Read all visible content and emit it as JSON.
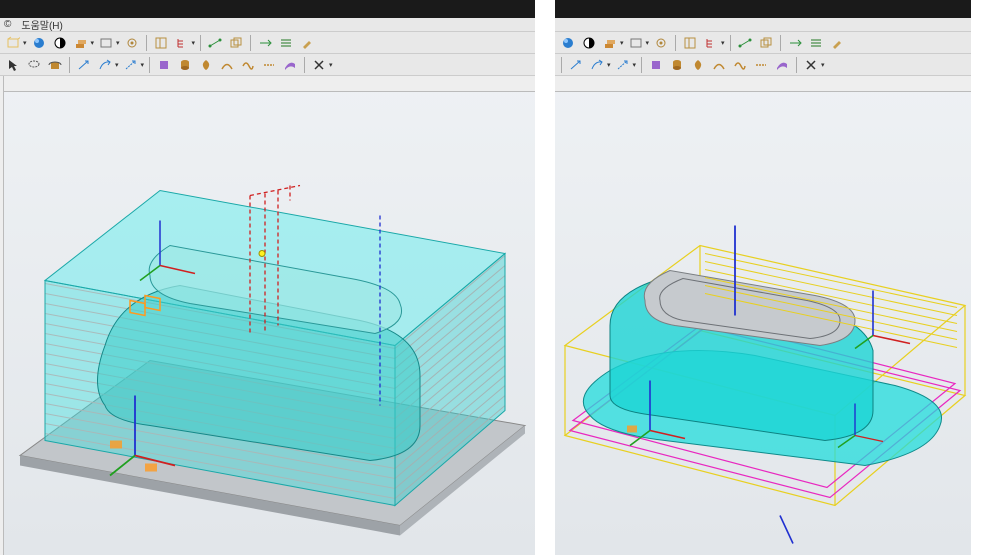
{
  "menus": {
    "windowHint": "©",
    "help": "도움말(H)"
  },
  "toolbar1": {
    "icons": [
      "box",
      "sphere",
      "halfblack",
      "boxstack",
      "rect",
      "dropdown",
      "gear",
      "sep",
      "clip",
      "tree",
      "dropdown",
      "sep",
      "dim",
      "dup",
      "sep",
      "align",
      "lines",
      "brush"
    ],
    "colors": {
      "box": "#e6c060",
      "sphere": "#2a7dcf",
      "halfblack": "#000000",
      "boxstack": "#cc8833",
      "rect": "#999999",
      "gear": "#b0863a",
      "clip": "#b89040",
      "tree": "#c03030",
      "dim": "#2a8f3a",
      "dup": "#b89040",
      "align": "#2a8f3a",
      "lines": "#227722",
      "brush": "#c9a050"
    }
  },
  "toolbar2": {
    "icons": [
      "ptr",
      "lasso",
      "rotcube",
      "sep",
      "arrow",
      "arrowpath",
      "dropdown",
      "arrowdash",
      "dropdown",
      "sep",
      "boxtool",
      "cyl",
      "lathe",
      "curve",
      "curve2",
      "dash",
      "sweep",
      "sep",
      "x",
      "dropdown"
    ],
    "colors": {
      "ptr": "#333333",
      "lasso": "#555555",
      "rotcube": "#c08830",
      "arrow": "#2a7dcf",
      "arrowpath": "#2a7dcf",
      "arrowdash": "#2a7dcf",
      "boxtool": "#9966cc",
      "cyl": "#c08830",
      "lathe": "#c08830",
      "curve": "#c08830",
      "curve2": "#c08830",
      "dash": "#c08830",
      "sweep": "#9966cc",
      "x": "#333333"
    }
  },
  "scene_left": {
    "stock_color": "#38e0e0",
    "stock_opacity": 0.45,
    "toolpath_color": "#ff6e6e",
    "base_color": "#b5b9bd",
    "axis_colors": {
      "x": "#d02020",
      "y": "#20a020",
      "z": "#2030d0"
    }
  },
  "scene_right": {
    "stock_color": "#20e0e0",
    "stock_opacity": 0.55,
    "box_colors": [
      "#ff2ad0",
      "#ffee20",
      "#ff2ad0"
    ],
    "axis_colors": {
      "x": "#d02020",
      "y": "#20a020",
      "z": "#2030d0"
    }
  }
}
